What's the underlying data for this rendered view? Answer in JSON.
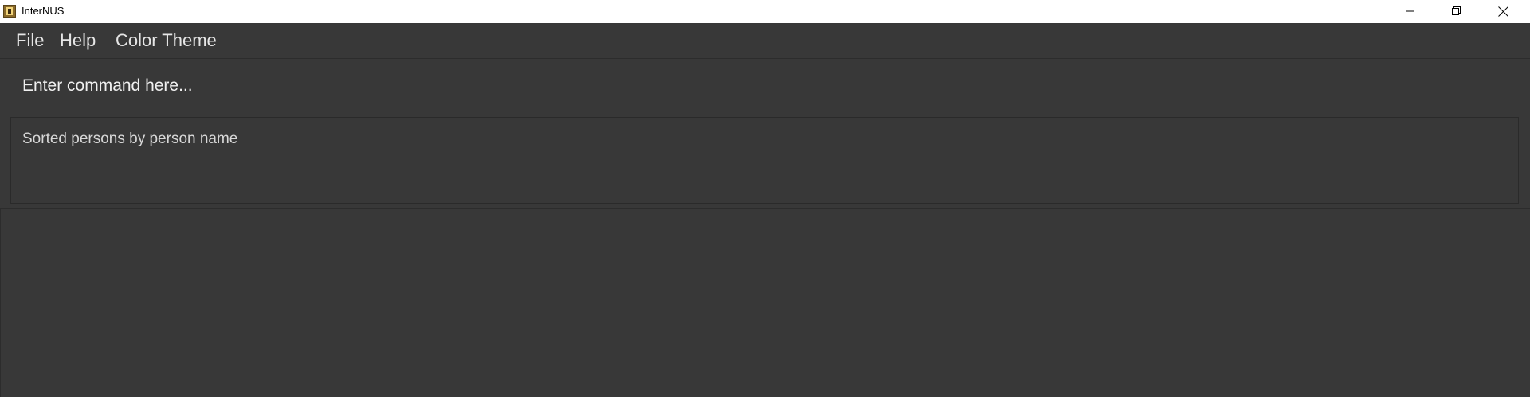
{
  "window": {
    "title": "InterNUS",
    "icon": "app-logo-icon",
    "controls": [
      "minimize-icon",
      "restore-icon",
      "close-icon"
    ]
  },
  "menu": {
    "items": [
      {
        "label": "File"
      },
      {
        "label": "Help"
      },
      {
        "label": "Color Theme"
      }
    ]
  },
  "command": {
    "placeholder": "Enter command here...",
    "value": ""
  },
  "result": {
    "message": "Sorted persons by person name"
  },
  "colors": {
    "background": "#383838",
    "text": "#e6e6e6",
    "titlebar": "#ffffff"
  }
}
